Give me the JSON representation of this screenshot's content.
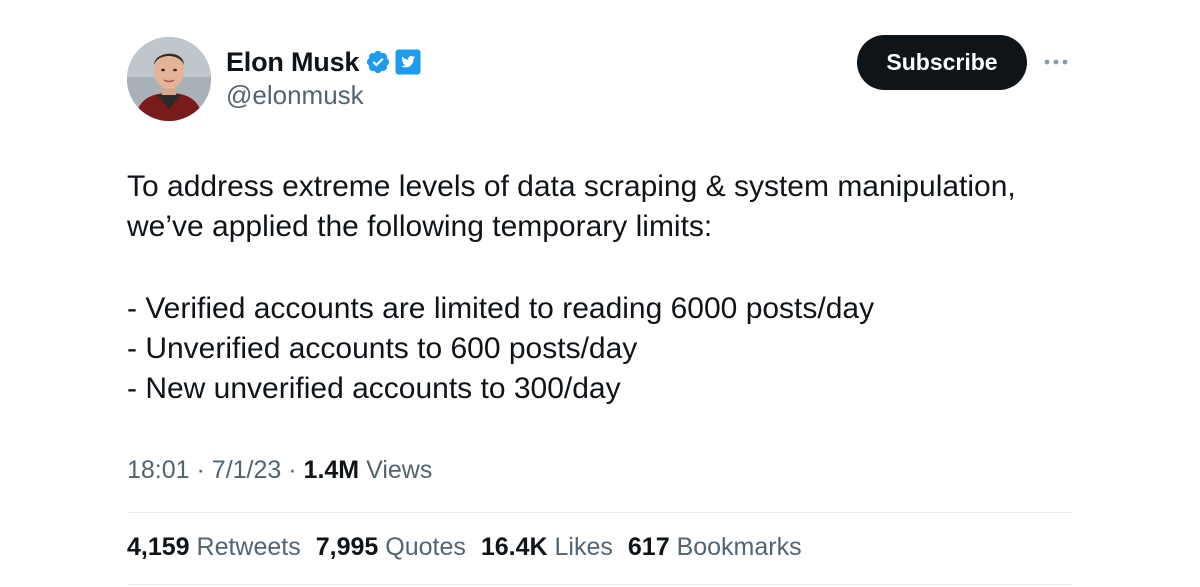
{
  "author": {
    "display_name": "Elon Musk",
    "handle": "@elonmusk",
    "verified_badge_icon": "verified-badge-icon",
    "affiliate_badge_icon": "twitter-bird-icon"
  },
  "actions": {
    "subscribe_label": "Subscribe",
    "more_icon": "more-dots-icon"
  },
  "tweet": {
    "lines": [
      "To address extreme levels of data scraping & system manipulation,",
      "we’ve applied the following temporary limits:",
      "",
      "- Verified accounts are limited to reading 6000 posts/day",
      "- Unverified accounts to 600 posts/day",
      "- New unverified accounts to 300/day"
    ]
  },
  "meta": {
    "time": "18:01",
    "separator": "·",
    "date": "7/1/23",
    "views_count": "1.4M",
    "views_label": "Views"
  },
  "stats": {
    "retweets_count": "4,159",
    "retweets_label": "Retweets",
    "quotes_count": "7,995",
    "quotes_label": "Quotes",
    "likes_count": "16.4K",
    "likes_label": "Likes",
    "bookmarks_count": "617",
    "bookmarks_label": "Bookmarks"
  },
  "colors": {
    "verified_blue": "#1d9bf0",
    "text_primary": "#0f1419",
    "text_secondary": "#536471",
    "subscribe_bg": "#0f1419"
  }
}
